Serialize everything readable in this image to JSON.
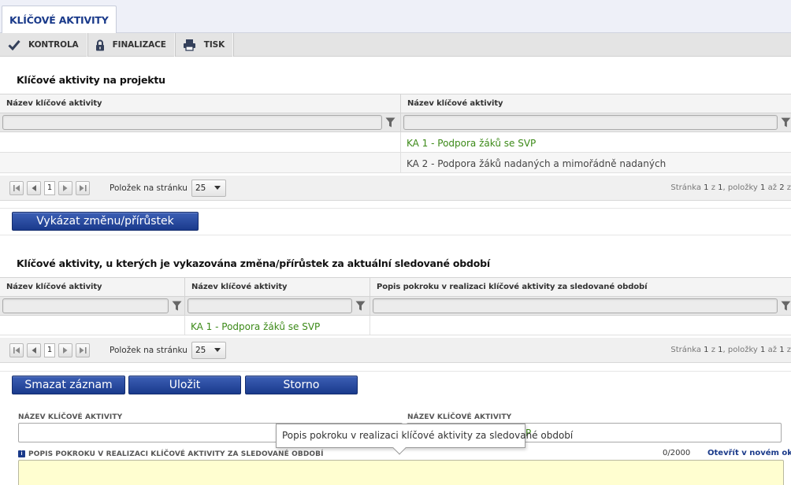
{
  "tab": {
    "label": "KLÍČOVÉ AKTIVITY"
  },
  "toolbar": {
    "items": [
      {
        "label": "KONTROLA",
        "icon": "checkmark-icon"
      },
      {
        "label": "FINALIZACE",
        "icon": "lock-icon"
      },
      {
        "label": "TISK",
        "icon": "printer-icon"
      }
    ]
  },
  "section1": {
    "title": "Klíčové aktivity na projektu",
    "columns": [
      "Název klíčové aktivity",
      "Název klíčové aktivity"
    ],
    "rows": [
      {
        "col1": "",
        "col2": "KA 1 - Podpora žáků se SVP"
      },
      {
        "col1": "",
        "col2": "KA 2 - Podpora žáků nadaných a mimořádně nadaných"
      }
    ],
    "pager": {
      "page": "1",
      "per_page_label": "Položek na stránku",
      "per_page": "25",
      "info_prefix": "Stránka",
      "info_page": "1",
      "info_of": "z",
      "info_total_pages": "1",
      "info_items": ", položky",
      "info_from": "1",
      "info_to_word": "až",
      "info_to": "2",
      "info_z": "z"
    }
  },
  "report_button": {
    "label": "Vykázat změnu/přírůstek"
  },
  "section2": {
    "title": "Klíčové aktivity, u kterých je vykazována změna/přírůstek za aktuální sledované období",
    "columns": [
      "Název klíčové aktivity",
      "Název klíčové aktivity",
      "Popis pokroku v realizaci klíčové aktivity za sledované období"
    ],
    "rows": [
      {
        "col1": "",
        "col2": "KA 1 - Podpora žáků se SVP",
        "col3": ""
      }
    ],
    "pager": {
      "page": "1",
      "per_page_label": "Položek na stránku",
      "per_page": "25",
      "info_prefix": "Stránka",
      "info_page": "1",
      "info_of": "z",
      "info_total_pages": "1",
      "info_items": ", položky",
      "info_from": "1",
      "info_to_word": "až",
      "info_to": "1",
      "info_z": "z"
    }
  },
  "actions": {
    "delete_label": "Smazat záznam",
    "save_label": "Uložit",
    "cancel_label": "Storno"
  },
  "form": {
    "field1_label": "NÁZEV KLÍČOVÉ AKTIVITY",
    "field2_label": "NÁZEV KLÍČOVÉ AKTIVITY",
    "field2_value_partial": "P",
    "description_label": "POPIS POKROKU V REALIZACI KLÍČOVÉ AKTIVITY ZA SLEDOVANÉ OBDOBÍ",
    "counter": "0/2000",
    "open_link": "Otevřít v novém okně",
    "tooltip": "Popis pokroku v realizaci klíčové aktivity za sledované období"
  },
  "colors": {
    "accent": "#1a3a8a",
    "green_link": "#3c8a18",
    "button_blue": "#2a4ca0",
    "textarea_bg": "#fffed0"
  }
}
